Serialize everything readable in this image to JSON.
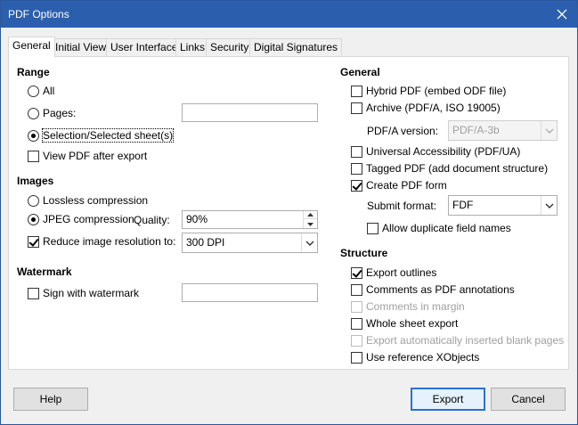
{
  "window": {
    "title": "PDF Options"
  },
  "tabs": [
    {
      "label": "General",
      "active": true
    },
    {
      "label": "Initial View"
    },
    {
      "label": "User Interface"
    },
    {
      "label": "Links"
    },
    {
      "label": "Security"
    },
    {
      "label": "Digital Signatures"
    }
  ],
  "range": {
    "heading": "Range",
    "all_label": "All",
    "pages_label": "Pages:",
    "pages_value": "",
    "selection_label": "Selection/Selected sheet(s)",
    "selected_option": "Selection/Selected sheet(s)",
    "view_pdf_label": "View PDF after export",
    "view_pdf_checked": false
  },
  "images": {
    "heading": "Images",
    "lossless_label": "Lossless compression",
    "jpeg_label": "JPEG compression",
    "quality_label": "Quality:",
    "quality_value": "90%",
    "reduce_label": "Reduce image resolution to:",
    "reduce_checked": true,
    "resolution_value": "300 DPI"
  },
  "watermark": {
    "heading": "Watermark",
    "sign_label": "Sign with watermark",
    "sign_checked": false,
    "text_value": ""
  },
  "general": {
    "heading": "General",
    "hybrid_label": "Hybrid PDF (embed ODF file)",
    "hybrid_checked": false,
    "archive_label": "Archive (PDF/A, ISO 19005)",
    "archive_checked": false,
    "pdfa_version_label": "PDF/A version:",
    "pdfa_version_value": "PDF/A-3b",
    "universal_label": "Universal Accessibility (PDF/UA)",
    "universal_checked": false,
    "tagged_label": "Tagged PDF (add document structure)",
    "tagged_checked": false,
    "create_form_label": "Create PDF form",
    "create_form_checked": true,
    "submit_format_label": "Submit format:",
    "submit_format_value": "FDF",
    "allow_dup_label": "Allow duplicate field names",
    "allow_dup_checked": false
  },
  "structure": {
    "heading": "Structure",
    "export_outlines_label": "Export outlines",
    "export_outlines_checked": true,
    "comments_pdf_label": "Comments as PDF annotations",
    "comments_pdf_checked": false,
    "comments_margin_label": "Comments in margin",
    "whole_sheet_label": "Whole sheet export",
    "whole_sheet_checked": false,
    "blank_pages_label": "Export automatically inserted blank pages",
    "reference_xobjects_label": "Use reference XObjects",
    "reference_xobjects_checked": false
  },
  "buttons": {
    "help": "Help",
    "export": "Export",
    "cancel": "Cancel"
  },
  "colors": {
    "titlebar": "#2b5fae",
    "default_button_border": "#2b6fd6",
    "disabled_text": "#a0a0a0"
  }
}
